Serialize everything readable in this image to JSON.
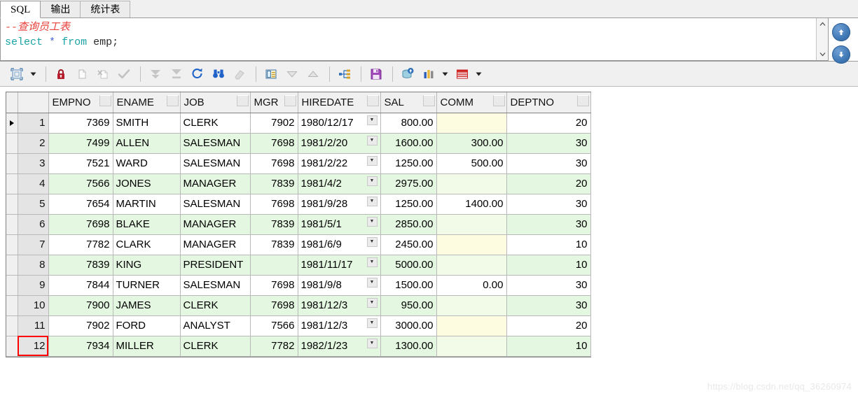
{
  "tabs": [
    {
      "label": "SQL",
      "active": true
    },
    {
      "label": "输出",
      "active": false
    },
    {
      "label": "统计表",
      "active": false
    }
  ],
  "editor": {
    "comment": "--查询员工表",
    "keyword_select": "select",
    "star": "*",
    "keyword_from": "from",
    "identifier": "emp;",
    "scroll_up": "⌃",
    "scroll_down": "⌄"
  },
  "side_buttons": [
    {
      "name": "scroll-up-circle",
      "glyph": "↑"
    },
    {
      "name": "scroll-down-circle",
      "glyph": "↓"
    }
  ],
  "toolbar": [
    {
      "name": "grid-mode-button",
      "icon": "grid-mode-icon"
    },
    {
      "name": "grid-mode-dropdown",
      "icon": "chevron-down-icon"
    },
    {
      "sep": true
    },
    {
      "name": "lock-button",
      "icon": "lock-icon"
    },
    {
      "name": "insert-record-button",
      "icon": "new-record-icon"
    },
    {
      "name": "delete-record-button",
      "icon": "delete-record-icon"
    },
    {
      "name": "post-edit-button",
      "icon": "check-icon"
    },
    {
      "sep": true
    },
    {
      "name": "fetch-next-page-button",
      "icon": "double-down-arrow-icon"
    },
    {
      "name": "fetch-last-page-button",
      "icon": "down-to-line-icon"
    },
    {
      "name": "refresh-button",
      "icon": "refresh-icon"
    },
    {
      "name": "find-button",
      "icon": "binoculars-icon"
    },
    {
      "name": "clear-filter-button",
      "icon": "eraser-icon"
    },
    {
      "sep": true
    },
    {
      "name": "single-record-view-button",
      "icon": "record-form-icon"
    },
    {
      "name": "move-down-button",
      "icon": "triangle-down-icon"
    },
    {
      "name": "move-up-button",
      "icon": "triangle-up-icon"
    },
    {
      "sep": true
    },
    {
      "name": "view-master-detail-button",
      "icon": "hierarchy-icon"
    },
    {
      "sep": true
    },
    {
      "name": "export-save-button",
      "icon": "floppy-disk-icon"
    },
    {
      "sep": true
    },
    {
      "name": "query-data-button",
      "icon": "db-upload-icon"
    },
    {
      "name": "chart-button",
      "icon": "bar-chart-icon"
    },
    {
      "name": "chart-dropdown",
      "icon": "chevron-down-icon"
    },
    {
      "name": "table-button",
      "icon": "table-grid-icon"
    },
    {
      "name": "table-dropdown",
      "icon": "chevron-down-icon"
    }
  ],
  "grid": {
    "columns": [
      "EMPNO",
      "ENAME",
      "JOB",
      "MGR",
      "HIREDATE",
      "SAL",
      "COMM",
      "DEPTNO"
    ],
    "selected_row_number": 12,
    "current_row_number": 1,
    "rows": [
      {
        "n": "1",
        "EMPNO": "7369",
        "ENAME": "SMITH",
        "JOB": "CLERK",
        "MGR": "7902",
        "HIREDATE": "1980/12/17",
        "SAL": "800.00",
        "COMM": "",
        "DEPTNO": "20"
      },
      {
        "n": "2",
        "EMPNO": "7499",
        "ENAME": "ALLEN",
        "JOB": "SALESMAN",
        "MGR": "7698",
        "HIREDATE": "1981/2/20",
        "SAL": "1600.00",
        "COMM": "300.00",
        "DEPTNO": "30"
      },
      {
        "n": "3",
        "EMPNO": "7521",
        "ENAME": "WARD",
        "JOB": "SALESMAN",
        "MGR": "7698",
        "HIREDATE": "1981/2/22",
        "SAL": "1250.00",
        "COMM": "500.00",
        "DEPTNO": "30"
      },
      {
        "n": "4",
        "EMPNO": "7566",
        "ENAME": "JONES",
        "JOB": "MANAGER",
        "MGR": "7839",
        "HIREDATE": "1981/4/2",
        "SAL": "2975.00",
        "COMM": "",
        "DEPTNO": "20"
      },
      {
        "n": "5",
        "EMPNO": "7654",
        "ENAME": "MARTIN",
        "JOB": "SALESMAN",
        "MGR": "7698",
        "HIREDATE": "1981/9/28",
        "SAL": "1250.00",
        "COMM": "1400.00",
        "DEPTNO": "30"
      },
      {
        "n": "6",
        "EMPNO": "7698",
        "ENAME": "BLAKE",
        "JOB": "MANAGER",
        "MGR": "7839",
        "HIREDATE": "1981/5/1",
        "SAL": "2850.00",
        "COMM": "",
        "DEPTNO": "30"
      },
      {
        "n": "7",
        "EMPNO": "7782",
        "ENAME": "CLARK",
        "JOB": "MANAGER",
        "MGR": "7839",
        "HIREDATE": "1981/6/9",
        "SAL": "2450.00",
        "COMM": "",
        "DEPTNO": "10"
      },
      {
        "n": "8",
        "EMPNO": "7839",
        "ENAME": "KING",
        "JOB": "PRESIDENT",
        "MGR": "",
        "HIREDATE": "1981/11/17",
        "SAL": "5000.00",
        "COMM": "",
        "DEPTNO": "10"
      },
      {
        "n": "9",
        "EMPNO": "7844",
        "ENAME": "TURNER",
        "JOB": "SALESMAN",
        "MGR": "7698",
        "HIREDATE": "1981/9/8",
        "SAL": "1500.00",
        "COMM": "0.00",
        "DEPTNO": "30"
      },
      {
        "n": "10",
        "EMPNO": "7900",
        "ENAME": "JAMES",
        "JOB": "CLERK",
        "MGR": "7698",
        "HIREDATE": "1981/12/3",
        "SAL": "950.00",
        "COMM": "",
        "DEPTNO": "30"
      },
      {
        "n": "11",
        "EMPNO": "7902",
        "ENAME": "FORD",
        "JOB": "ANALYST",
        "MGR": "7566",
        "HIREDATE": "1981/12/3",
        "SAL": "3000.00",
        "COMM": "",
        "DEPTNO": "20"
      },
      {
        "n": "12",
        "EMPNO": "7934",
        "ENAME": "MILLER",
        "JOB": "CLERK",
        "MGR": "7782",
        "HIREDATE": "1982/1/23",
        "SAL": "1300.00",
        "COMM": "",
        "DEPTNO": "10"
      }
    ]
  },
  "watermark": "https://blog.csdn.net/qq_36260974",
  "colors": {
    "comment": "#e8403a",
    "keyword": "#1ba3a3",
    "row_stripe": "#e4f7e0",
    "null_cell": "#fdfbe0",
    "selection_outline": "#ff0000"
  }
}
